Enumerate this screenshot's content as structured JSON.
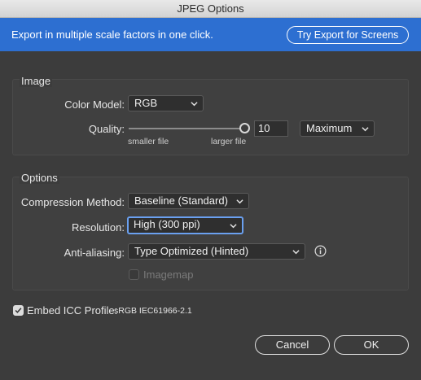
{
  "window": {
    "title": "JPEG Options"
  },
  "banner": {
    "text": "Export in multiple scale factors in one click.",
    "button_label": "Try Export for Screens"
  },
  "image_group": {
    "title": "Image",
    "color_model_label": "Color Model:",
    "color_model_value": "RGB",
    "quality_label": "Quality:",
    "quality_min_caption": "smaller file",
    "quality_max_caption": "larger file",
    "quality_value": "10",
    "quality_preset": "Maximum"
  },
  "options_group": {
    "title": "Options",
    "compression_label": "Compression Method:",
    "compression_value": "Baseline (Standard)",
    "resolution_label": "Resolution:",
    "resolution_value": "High (300 ppi)",
    "antialias_label": "Anti-aliasing:",
    "antialias_value": "Type Optimized (Hinted)",
    "imagemap_label": "Imagemap"
  },
  "icc": {
    "label": "Embed ICC Profile:",
    "value": "sRGB IEC61966-2.1"
  },
  "buttons": {
    "cancel": "Cancel",
    "ok": "OK"
  },
  "colors": {
    "banner": "#2d6fd1",
    "dialog_bg": "#3c3c3c",
    "focus_ring": "#6aa0f0"
  }
}
